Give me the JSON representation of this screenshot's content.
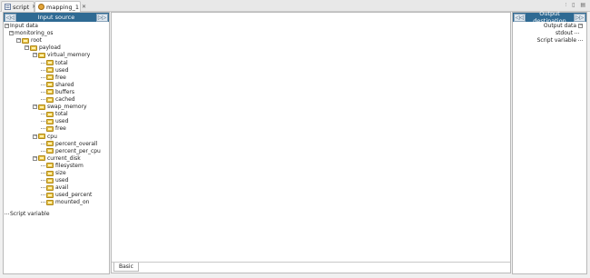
{
  "tabs": [
    {
      "label": "script",
      "icon": "script-icon",
      "close": "✕"
    },
    {
      "label": "mapping_1",
      "icon": "mapping-icon",
      "close": "✕"
    }
  ],
  "window_controls": "⫶ ▯ ▤",
  "input_panel": {
    "title": "Input source",
    "collapse_left": "◁◁",
    "collapse_right": "▷▷",
    "tree": [
      {
        "label": "Input data",
        "level": 0,
        "type": "root"
      },
      {
        "label": "monitoring_os",
        "level": 1,
        "type": "node"
      },
      {
        "label": "root",
        "level": 2,
        "type": "folder"
      },
      {
        "label": "payload",
        "level": 3,
        "type": "folder"
      },
      {
        "label": "virtual_memory",
        "level": 4,
        "type": "folder"
      },
      {
        "label": "total",
        "level": 5,
        "type": "leaf"
      },
      {
        "label": "used",
        "level": 5,
        "type": "leaf"
      },
      {
        "label": "free",
        "level": 5,
        "type": "leaf"
      },
      {
        "label": "shared",
        "level": 5,
        "type": "leaf"
      },
      {
        "label": "buffers",
        "level": 5,
        "type": "leaf"
      },
      {
        "label": "cached",
        "level": 5,
        "type": "leaf"
      },
      {
        "label": "swap_memory",
        "level": 4,
        "type": "folder"
      },
      {
        "label": "total",
        "level": 5,
        "type": "leaf"
      },
      {
        "label": "used",
        "level": 5,
        "type": "leaf"
      },
      {
        "label": "free",
        "level": 5,
        "type": "leaf"
      },
      {
        "label": "cpu",
        "level": 4,
        "type": "folder"
      },
      {
        "label": "percent_overall",
        "level": 5,
        "type": "leaf"
      },
      {
        "label": "percent_per_cpu",
        "level": 5,
        "type": "leaf"
      },
      {
        "label": "current_disk",
        "level": 4,
        "type": "folder"
      },
      {
        "label": "filesystem",
        "level": 5,
        "type": "leaf"
      },
      {
        "label": "size",
        "level": 5,
        "type": "leaf"
      },
      {
        "label": "used",
        "level": 5,
        "type": "leaf"
      },
      {
        "label": "avail",
        "level": 5,
        "type": "leaf"
      },
      {
        "label": "used_percent",
        "level": 5,
        "type": "leaf"
      },
      {
        "label": "mounted_on",
        "level": 5,
        "type": "leaf"
      },
      {
        "label": "Script variable",
        "level": 0,
        "type": "root-leaf"
      }
    ]
  },
  "output_panel": {
    "title": "Output destination",
    "collapse_left": "◁◁",
    "collapse_right": "▷▷",
    "items": [
      {
        "label": "Output data"
      },
      {
        "label": "stdout"
      },
      {
        "label": "Script variable"
      }
    ]
  },
  "center": {
    "bottom_tab": "Basic"
  }
}
